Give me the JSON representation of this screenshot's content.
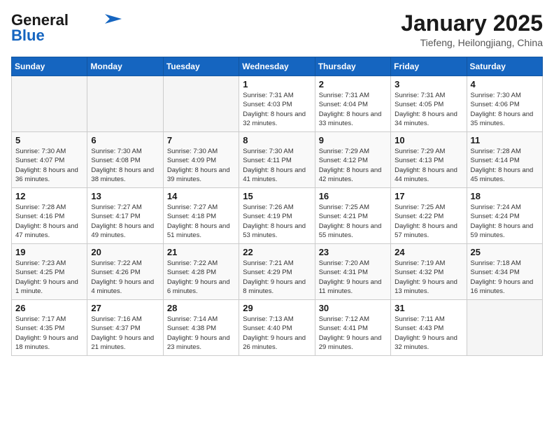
{
  "logo": {
    "line1": "General",
    "line2": "Blue"
  },
  "header": {
    "title": "January 2025",
    "subtitle": "Tiefeng, Heilongjiang, China"
  },
  "weekdays": [
    "Sunday",
    "Monday",
    "Tuesday",
    "Wednesday",
    "Thursday",
    "Friday",
    "Saturday"
  ],
  "weeks": [
    [
      {
        "day": "",
        "info": ""
      },
      {
        "day": "",
        "info": ""
      },
      {
        "day": "",
        "info": ""
      },
      {
        "day": "1",
        "info": "Sunrise: 7:31 AM\nSunset: 4:03 PM\nDaylight: 8 hours and 32 minutes."
      },
      {
        "day": "2",
        "info": "Sunrise: 7:31 AM\nSunset: 4:04 PM\nDaylight: 8 hours and 33 minutes."
      },
      {
        "day": "3",
        "info": "Sunrise: 7:31 AM\nSunset: 4:05 PM\nDaylight: 8 hours and 34 minutes."
      },
      {
        "day": "4",
        "info": "Sunrise: 7:30 AM\nSunset: 4:06 PM\nDaylight: 8 hours and 35 minutes."
      }
    ],
    [
      {
        "day": "5",
        "info": "Sunrise: 7:30 AM\nSunset: 4:07 PM\nDaylight: 8 hours and 36 minutes."
      },
      {
        "day": "6",
        "info": "Sunrise: 7:30 AM\nSunset: 4:08 PM\nDaylight: 8 hours and 38 minutes."
      },
      {
        "day": "7",
        "info": "Sunrise: 7:30 AM\nSunset: 4:09 PM\nDaylight: 8 hours and 39 minutes."
      },
      {
        "day": "8",
        "info": "Sunrise: 7:30 AM\nSunset: 4:11 PM\nDaylight: 8 hours and 41 minutes."
      },
      {
        "day": "9",
        "info": "Sunrise: 7:29 AM\nSunset: 4:12 PM\nDaylight: 8 hours and 42 minutes."
      },
      {
        "day": "10",
        "info": "Sunrise: 7:29 AM\nSunset: 4:13 PM\nDaylight: 8 hours and 44 minutes."
      },
      {
        "day": "11",
        "info": "Sunrise: 7:28 AM\nSunset: 4:14 PM\nDaylight: 8 hours and 45 minutes."
      }
    ],
    [
      {
        "day": "12",
        "info": "Sunrise: 7:28 AM\nSunset: 4:16 PM\nDaylight: 8 hours and 47 minutes."
      },
      {
        "day": "13",
        "info": "Sunrise: 7:27 AM\nSunset: 4:17 PM\nDaylight: 8 hours and 49 minutes."
      },
      {
        "day": "14",
        "info": "Sunrise: 7:27 AM\nSunset: 4:18 PM\nDaylight: 8 hours and 51 minutes."
      },
      {
        "day": "15",
        "info": "Sunrise: 7:26 AM\nSunset: 4:19 PM\nDaylight: 8 hours and 53 minutes."
      },
      {
        "day": "16",
        "info": "Sunrise: 7:25 AM\nSunset: 4:21 PM\nDaylight: 8 hours and 55 minutes."
      },
      {
        "day": "17",
        "info": "Sunrise: 7:25 AM\nSunset: 4:22 PM\nDaylight: 8 hours and 57 minutes."
      },
      {
        "day": "18",
        "info": "Sunrise: 7:24 AM\nSunset: 4:24 PM\nDaylight: 8 hours and 59 minutes."
      }
    ],
    [
      {
        "day": "19",
        "info": "Sunrise: 7:23 AM\nSunset: 4:25 PM\nDaylight: 9 hours and 1 minute."
      },
      {
        "day": "20",
        "info": "Sunrise: 7:22 AM\nSunset: 4:26 PM\nDaylight: 9 hours and 4 minutes."
      },
      {
        "day": "21",
        "info": "Sunrise: 7:22 AM\nSunset: 4:28 PM\nDaylight: 9 hours and 6 minutes."
      },
      {
        "day": "22",
        "info": "Sunrise: 7:21 AM\nSunset: 4:29 PM\nDaylight: 9 hours and 8 minutes."
      },
      {
        "day": "23",
        "info": "Sunrise: 7:20 AM\nSunset: 4:31 PM\nDaylight: 9 hours and 11 minutes."
      },
      {
        "day": "24",
        "info": "Sunrise: 7:19 AM\nSunset: 4:32 PM\nDaylight: 9 hours and 13 minutes."
      },
      {
        "day": "25",
        "info": "Sunrise: 7:18 AM\nSunset: 4:34 PM\nDaylight: 9 hours and 16 minutes."
      }
    ],
    [
      {
        "day": "26",
        "info": "Sunrise: 7:17 AM\nSunset: 4:35 PM\nDaylight: 9 hours and 18 minutes."
      },
      {
        "day": "27",
        "info": "Sunrise: 7:16 AM\nSunset: 4:37 PM\nDaylight: 9 hours and 21 minutes."
      },
      {
        "day": "28",
        "info": "Sunrise: 7:14 AM\nSunset: 4:38 PM\nDaylight: 9 hours and 23 minutes."
      },
      {
        "day": "29",
        "info": "Sunrise: 7:13 AM\nSunset: 4:40 PM\nDaylight: 9 hours and 26 minutes."
      },
      {
        "day": "30",
        "info": "Sunrise: 7:12 AM\nSunset: 4:41 PM\nDaylight: 9 hours and 29 minutes."
      },
      {
        "day": "31",
        "info": "Sunrise: 7:11 AM\nSunset: 4:43 PM\nDaylight: 9 hours and 32 minutes."
      },
      {
        "day": "",
        "info": ""
      }
    ]
  ]
}
